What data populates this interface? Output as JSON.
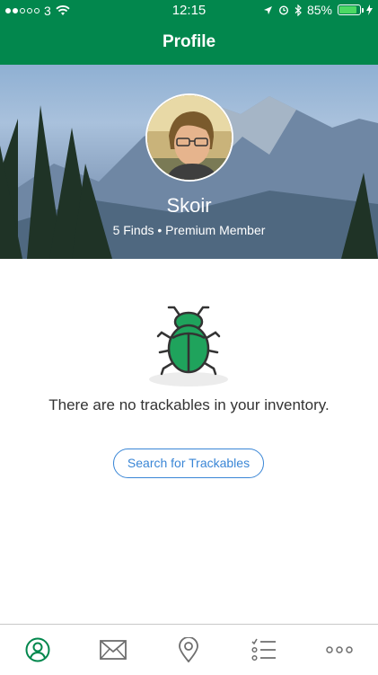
{
  "status_bar": {
    "carrier": "3",
    "time": "12:15",
    "battery": "85%",
    "battery_level": 0.85,
    "signal_bars": 2
  },
  "nav": {
    "title": "Profile"
  },
  "profile": {
    "username": "Skoir",
    "subtitle": "5 Finds • Premium Member"
  },
  "empty_state": {
    "message": "There are no trackables in your inventory.",
    "button_label": "Search for Trackables",
    "icon": "bug-icon"
  },
  "tab_bar": {
    "items": [
      {
        "icon": "profile-icon",
        "active": true
      },
      {
        "icon": "mail-icon",
        "active": false
      },
      {
        "icon": "map-pin-icon",
        "active": false
      },
      {
        "icon": "list-icon",
        "active": false
      },
      {
        "icon": "more-icon",
        "active": false
      }
    ]
  },
  "colors": {
    "brand_green": "#02874d",
    "bug_green": "#1fa35c",
    "link_blue": "#3a86d6",
    "icon_gray": "#6e6e6e"
  }
}
